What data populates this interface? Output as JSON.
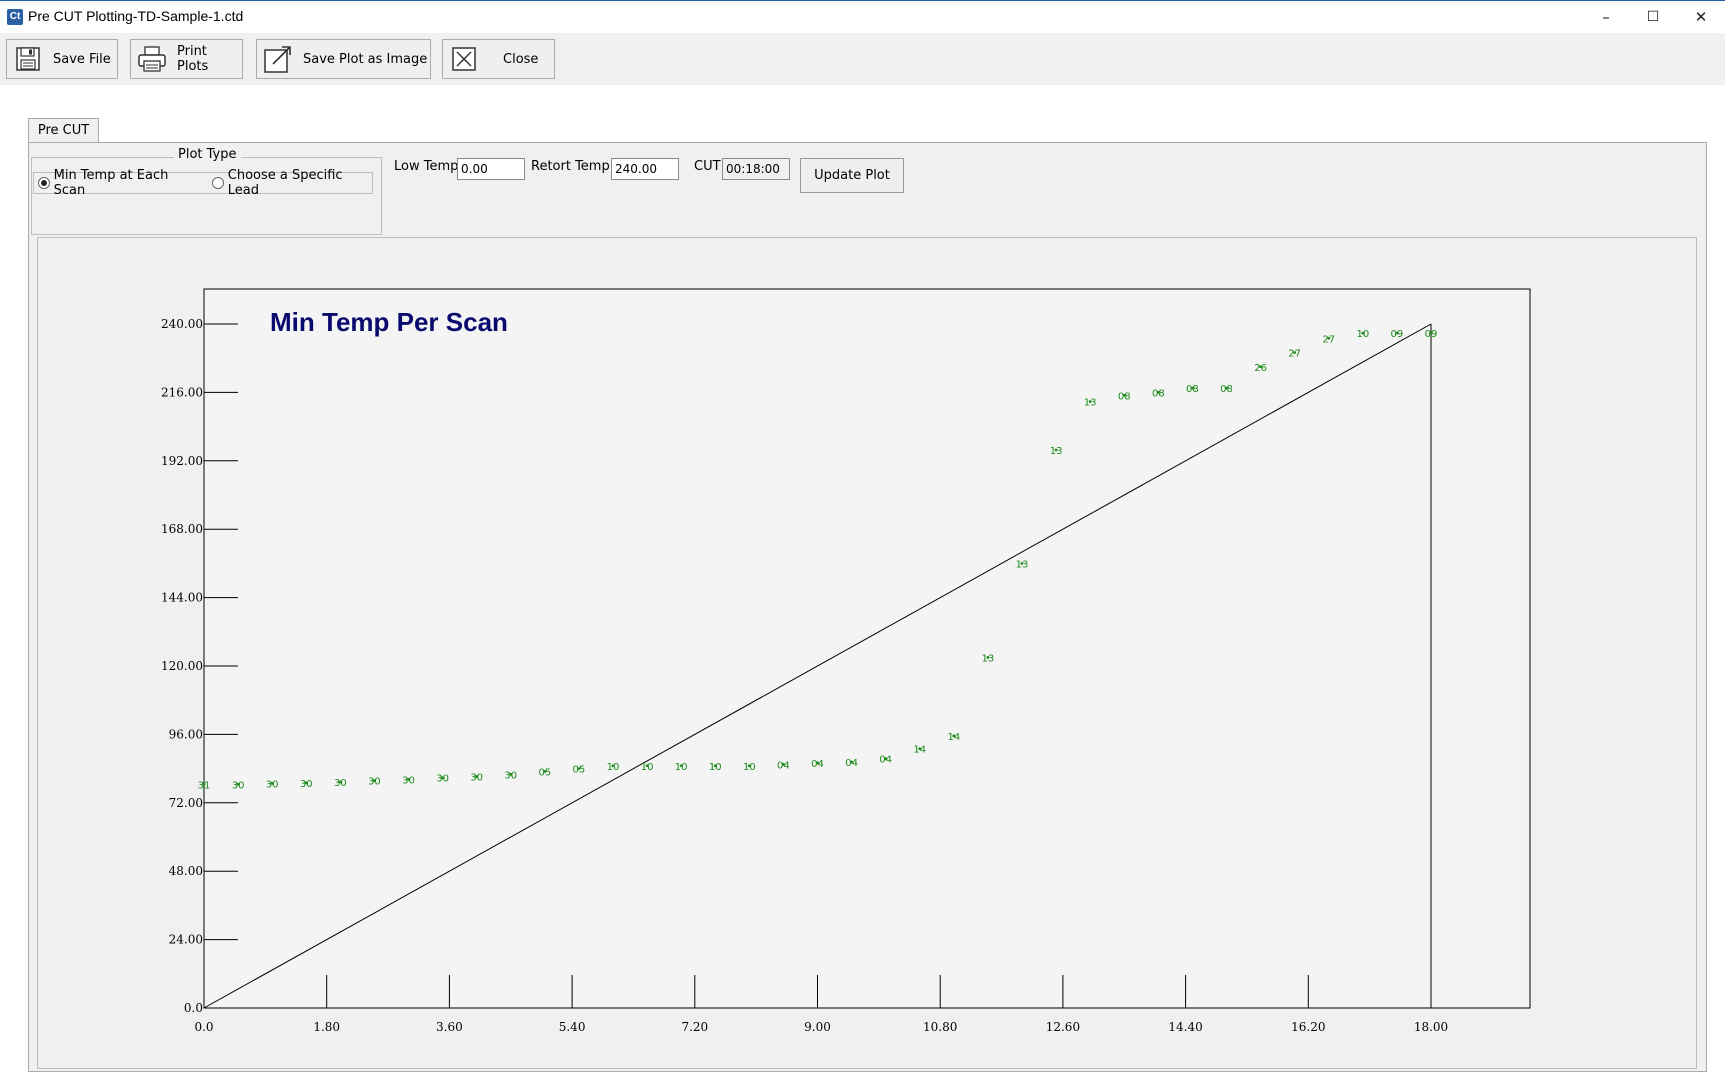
{
  "window": {
    "title": "Pre CUT Plotting-TD-Sample-1.ctd",
    "app_icon": "Ct",
    "minimize": "–",
    "maximize": "☐",
    "close": "✕"
  },
  "toolbar": {
    "save_file": "Save File",
    "print_plots": "Print Plots",
    "save_image": "Save Plot as Image",
    "close": "Close"
  },
  "tab": {
    "label": "Pre CUT"
  },
  "plot_type": {
    "legend": "Plot Type",
    "option_min": "Min Temp at Each Scan",
    "option_lead": "Choose a Specific Lead",
    "selected": "Min Temp at Each Scan"
  },
  "fields": {
    "low_temp_label": "Low Temp",
    "low_temp_value": "0.00",
    "retort_temp_label": "Retort Temp",
    "retort_temp_value": "240.00",
    "cut_label": "CUT",
    "cut_value": "00:18:00"
  },
  "update_button": "Update Plot",
  "chart_data": {
    "type": "scatter",
    "title": "Min Temp Per Scan",
    "xlim": [
      0,
      18
    ],
    "ylim": [
      0,
      240
    ],
    "x_ticks": [
      "0.0",
      "1.80",
      "3.60",
      "5.40",
      "7.20",
      "9.00",
      "10.80",
      "12.60",
      "14.40",
      "16.20",
      "18.00"
    ],
    "y_ticks": [
      "0.0",
      "24.00",
      "48.00",
      "72.00",
      "96.00",
      "120.00",
      "144.00",
      "168.00",
      "192.00",
      "216.00",
      "240.00"
    ],
    "reference_line": {
      "from": [
        0,
        0
      ],
      "to": [
        18,
        240
      ]
    },
    "marker_color": "#1a8a1a",
    "points": [
      {
        "x": 0.0,
        "y": 78.5,
        "label": "31"
      },
      {
        "x": 0.5,
        "y": 78.5,
        "label": "30"
      },
      {
        "x": 1.0,
        "y": 78.8,
        "label": "30"
      },
      {
        "x": 1.5,
        "y": 79.0,
        "label": "30"
      },
      {
        "x": 2.0,
        "y": 79.3,
        "label": "30"
      },
      {
        "x": 2.5,
        "y": 79.8,
        "label": "30"
      },
      {
        "x": 3.0,
        "y": 80.2,
        "label": "30"
      },
      {
        "x": 3.5,
        "y": 80.8,
        "label": "30"
      },
      {
        "x": 4.0,
        "y": 81.2,
        "label": "30"
      },
      {
        "x": 4.5,
        "y": 82.0,
        "label": "30"
      },
      {
        "x": 5.0,
        "y": 83.0,
        "label": "05"
      },
      {
        "x": 5.5,
        "y": 84.0,
        "label": "05"
      },
      {
        "x": 6.0,
        "y": 85.0,
        "label": "10"
      },
      {
        "x": 6.5,
        "y": 85.0,
        "label": "10"
      },
      {
        "x": 7.0,
        "y": 85.0,
        "label": "10"
      },
      {
        "x": 7.5,
        "y": 85.0,
        "label": "10"
      },
      {
        "x": 8.0,
        "y": 85.0,
        "label": "10"
      },
      {
        "x": 8.5,
        "y": 85.5,
        "label": "04"
      },
      {
        "x": 9.0,
        "y": 86.0,
        "label": "04"
      },
      {
        "x": 9.5,
        "y": 86.3,
        "label": "04"
      },
      {
        "x": 10.0,
        "y": 87.5,
        "label": "04"
      },
      {
        "x": 10.5,
        "y": 91.0,
        "label": "14"
      },
      {
        "x": 11.0,
        "y": 95.5,
        "label": "14"
      },
      {
        "x": 11.5,
        "y": 123.0,
        "label": "13"
      },
      {
        "x": 12.0,
        "y": 156.0,
        "label": "13"
      },
      {
        "x": 12.5,
        "y": 195.8,
        "label": "13"
      },
      {
        "x": 13.0,
        "y": 212.8,
        "label": "13"
      },
      {
        "x": 13.5,
        "y": 215.0,
        "label": "08"
      },
      {
        "x": 14.0,
        "y": 216.0,
        "label": "08"
      },
      {
        "x": 14.5,
        "y": 217.5,
        "label": "08"
      },
      {
        "x": 15.0,
        "y": 217.5,
        "label": "08"
      },
      {
        "x": 15.5,
        "y": 225.0,
        "label": "26"
      },
      {
        "x": 16.0,
        "y": 230.0,
        "label": "27"
      },
      {
        "x": 16.5,
        "y": 235.0,
        "label": "27"
      },
      {
        "x": 17.0,
        "y": 236.8,
        "label": "10"
      },
      {
        "x": 17.5,
        "y": 236.8,
        "label": "09"
      },
      {
        "x": 18.0,
        "y": 236.8,
        "label": "09"
      }
    ]
  }
}
